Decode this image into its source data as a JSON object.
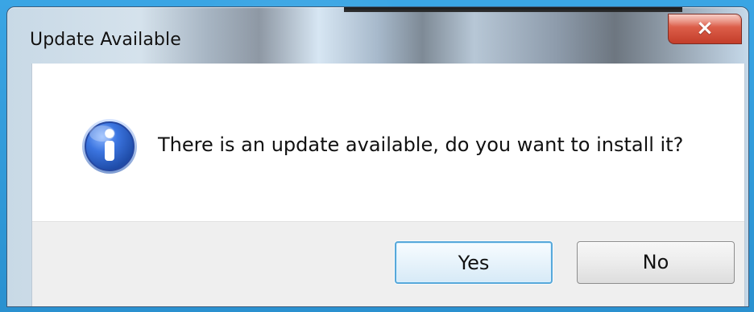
{
  "window": {
    "title": "Update Available"
  },
  "dialog": {
    "message": "There is an update available, do you want to install it?"
  },
  "buttons": {
    "yes_label": "Yes",
    "no_label": "No"
  },
  "icons": {
    "close": "close-icon",
    "info": "info-icon"
  },
  "colors": {
    "desktop_blue": "#2f98d7",
    "close_red": "#c33d2a",
    "yes_focus_border": "#57a8da",
    "info_blue": "#2d5fca"
  }
}
